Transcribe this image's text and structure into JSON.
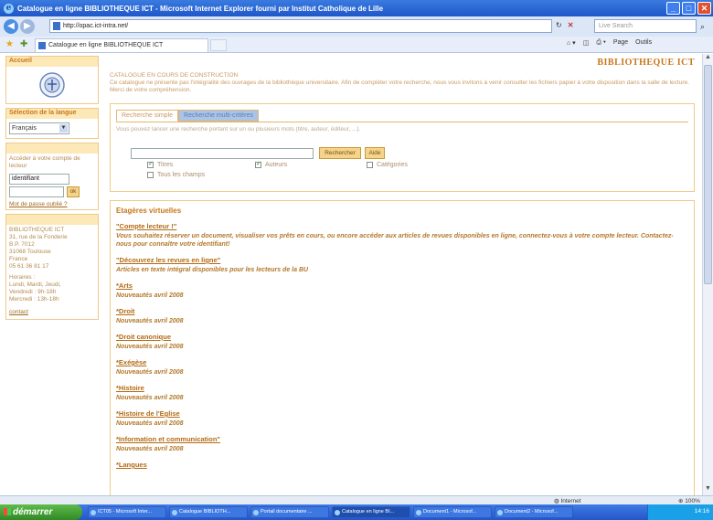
{
  "window": {
    "title": "Catalogue en ligne BIBLIOTHEQUE ICT - Microsoft Internet Explorer fourni par Institut Catholique de Lille"
  },
  "browser": {
    "address": "http://opac.ict-intra.net/",
    "search_placeholder": "Live Search",
    "tab_title": "Catalogue en ligne BIBLIOTHEQUE ICT",
    "commands": [
      "Page",
      "Outils"
    ],
    "status_zone": "Internet",
    "zoom": "100%"
  },
  "sidebar": {
    "accueil": "Accueil",
    "lang_title": "Sélection de la langue",
    "lang_value": "Français",
    "login_hint": "Accéder à votre compte de lecteur",
    "login_value": "identifiant",
    "ok_label": "ok",
    "forgot_label": "Mot de passe oublié ?",
    "address_lines": [
      "BIBLIOTHEQUE ICT",
      "31, rue de la Fonderie",
      "B.P. 7012",
      "31068 Toulouse",
      "France",
      "05 61 36 81 17"
    ],
    "hours_lines": [
      "Horaires :",
      "Lundi, Mardi, Jeudi,",
      "Vendredi : 9h-18h",
      "Mercredi : 13h-18h"
    ],
    "contact_label": "contact"
  },
  "main": {
    "library_title": "BIBLIOTHEQUE ICT",
    "notice_title": "CATALOGUE EN COURS DE CONSTRUCTION",
    "notice_text": "Ce catalogue ne présente pas l'intégralité des ouvrages de la bibliothèque universitaire. Afin de compléter votre recherche, nous vous invitons à venir consulter les fichiers papier à votre disposition dans la salle de lecture. Merci de votre compréhension.",
    "tab_simple": "Recherche simple",
    "tab_multi": "Recherche multi-critères",
    "search_hint": "Vous pouvez lancer une recherche portant sur un ou plusieurs mots (titre, auteur, éditeur, ...).",
    "btn_search": "Rechercher",
    "btn_help": "Aide",
    "opt_titres": "Titres",
    "opt_auteurs": "Auteurs",
    "opt_categories": "Catégories",
    "opt_tous": "Tous les champs",
    "shelves_title": "Etagères virtuelles",
    "shelves": [
      {
        "link": "\"Compte lecteur !\"",
        "desc": "Vous souhaitez réserver un document, visualiser vos prêts en cours, ou encore accéder aux articles de revues disponibles en ligne, connectez-vous à votre compte lecteur. Contactez-nous pour connaître votre identifiant!"
      },
      {
        "link": "\"Découvrez les revues en ligne\"",
        "desc": "Articles en texte intégral disponibles pour les lecteurs de la BU"
      },
      {
        "link": "*Arts",
        "desc": "Nouveautés avril 2008"
      },
      {
        "link": "*Droit",
        "desc": "Nouveautés avril 2008"
      },
      {
        "link": "*Droit canonique",
        "desc": "Nouveautés avril 2008"
      },
      {
        "link": "*Exégèse",
        "desc": "Nouveautés avril 2008"
      },
      {
        "link": "*Histoire",
        "desc": "Nouveautés avril 2008"
      },
      {
        "link": "*Histoire de l'Eglise",
        "desc": "Nouveautés avril 2008"
      },
      {
        "link": "*Information et communication\"",
        "desc": "Nouveautés avril 2008"
      },
      {
        "link": "*Langues",
        "desc": ""
      }
    ]
  },
  "taskbar": {
    "start_label": "démarrer",
    "tasks": [
      "ICT05 - Microsoft Inter...",
      "Catalogue BIBLIOTH...",
      "Portail documentaire ...",
      "Catalogue en ligne BI...",
      "Document1 - Microsof...",
      "Document2 - Microsof..."
    ],
    "clock": "14:16"
  }
}
